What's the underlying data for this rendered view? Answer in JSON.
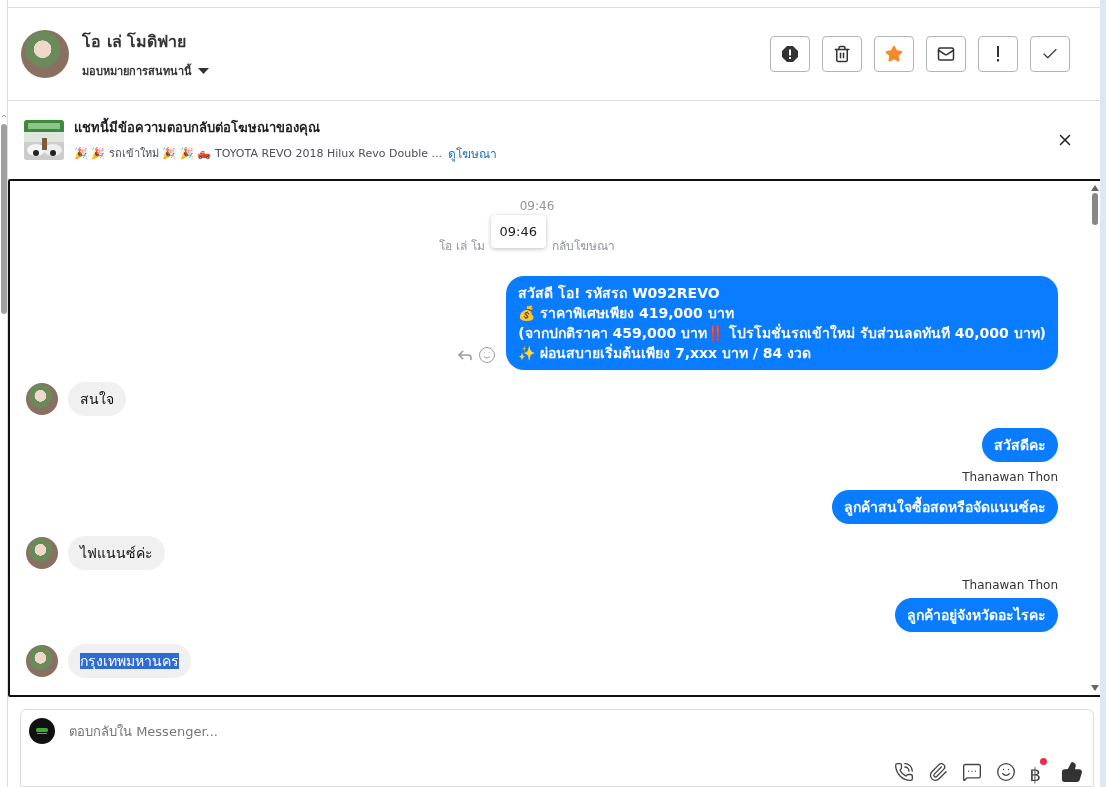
{
  "contact": {
    "name": "โอ เล่ โมดิฟาย",
    "assign_label": "มอบหมายการสนทนานี้"
  },
  "toolbar_buttons": [
    {
      "kind": "report"
    },
    {
      "kind": "delete"
    },
    {
      "kind": "star",
      "on": true
    },
    {
      "kind": "mail"
    },
    {
      "kind": "important"
    },
    {
      "kind": "done"
    }
  ],
  "ad_banner": {
    "title": "แชทนี้มีข้อความตอบกลับต่อโฆษณาของคุณ",
    "snippet": "🎉 🎉 รถเข้าใหม่ 🎉 🎉 🛻 TOYOTA REVO 2018 Hilux Revo Double ...",
    "link": "ดูโฆษณา"
  },
  "chat": {
    "timestamp": "09:46",
    "note_parts": [
      "โอ เล่ โม",
      "กลับโฆษณา"
    ],
    "tooltip": "09:46",
    "messages": [
      {
        "kind": "outgoing",
        "lines": [
          "สวัสดี โอ! รหัสรถ W092REVO",
          "💰 ราคาพิเศษเพียง 419,000 บาท",
          "(จากปกติราคา  459,000 บาท‼️ โปรโมชั่นรถเข้าใหม่ รับส่วนลดทันที 40,000 บาท)",
          "✨ ผ่อนสบายเริ่มต้นเพียง 7,xxx บาท / 84 งวด"
        ],
        "actions": true,
        "selected": false
      },
      {
        "kind": "incoming",
        "lines": [
          "สนใจ"
        ],
        "selected": false
      },
      {
        "kind": "outgoing",
        "lines": [
          "สวัสดีคะ"
        ],
        "selected": false
      },
      {
        "kind": "outgoing",
        "sender": "Thanawan Thon",
        "lines": [
          "ลูกค้าสนใจซื้อสดหรือจัดแนนซ์คะ"
        ],
        "selected": false
      },
      {
        "kind": "incoming",
        "lines": [
          "ไฟแนนซ์ค่ะ"
        ],
        "selected": false
      },
      {
        "kind": "outgoing",
        "sender": "Thanawan Thon",
        "lines": [
          "ลูกค้าอยู่จังหวัดอะไรคะ"
        ],
        "selected": false
      },
      {
        "kind": "incoming",
        "lines": [
          "กรุงเทพมหานคร"
        ],
        "selected": true
      }
    ]
  },
  "composer": {
    "placeholder": "ตอบกลับใน Messenger...",
    "tools": [
      {
        "kind": "call"
      },
      {
        "kind": "attach"
      },
      {
        "kind": "chat"
      },
      {
        "kind": "emoji"
      },
      {
        "kind": "baht",
        "label": "฿",
        "badge": true
      },
      {
        "kind": "like"
      }
    ]
  }
}
